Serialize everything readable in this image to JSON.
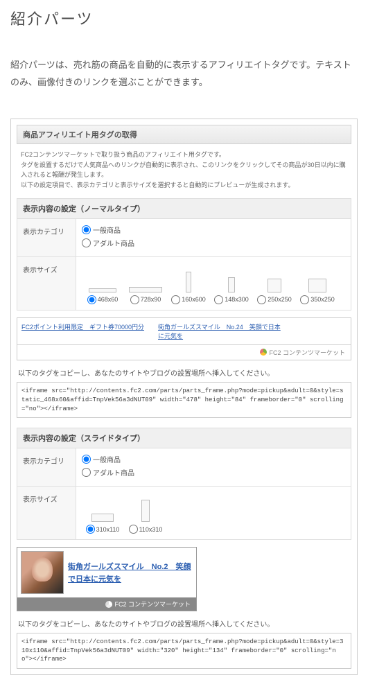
{
  "page": {
    "title": "紹介パーツ",
    "intro": "紹介パーツは、売れ筋の商品を自動的に表示するアフィリエイトタグです。テキストのみ、画像付きのリンクを選ぶことができます。"
  },
  "panel": {
    "header": "商品アフィリエイト用タグの取得",
    "desc_line1": "FC2コンテンツマーケットで取り扱う商品のアフィリエイト用タグです。",
    "desc_line2": "タグを設置するだけで人気商品へのリンクが自動的に表示され、このリンクをクリックしてその商品が30日以内に購入されると報酬が発生します。",
    "desc_line3": "以下の設定項目で、表示カテゴリと表示サイズを選択すると自動的にプレビューが生成されます。"
  },
  "normal": {
    "section_title": "表示内容の設定（ノーマルタイプ）",
    "category_label": "表示カテゴリ",
    "cat_general": "一般商品",
    "cat_adult": "アダルト商品",
    "size_label": "表示サイズ",
    "sizes": {
      "s1": "468x60",
      "s2": "728x90",
      "s3": "160x600",
      "s4": "148x300",
      "s5": "250x250",
      "s6": "350x250"
    },
    "preview_link1": "FC2ポイント利用限定　ギフト券70000円分",
    "preview_link2": "街角ガールズスマイル　No.24　笑顔で日本に元気を",
    "preview_footer": "FC2 コンテンツマーケット",
    "copy_instruction": "以下のタグをコピーし、あなたのサイトやブログの設置場所へ挿入してください。",
    "code": "<iframe src=\"http://contents.fc2.com/parts/parts_frame.php?mode=pickup&adult=0&style=static_468x60&affid=TnpVek56a3dNUT09\" width=\"478\" height=\"84\" frameborder=\"0\" scrolling=\"no\"></iframe>"
  },
  "slide": {
    "section_title": "表示内容の設定（スライドタイプ）",
    "category_label": "表示カテゴリ",
    "cat_general": "一般商品",
    "cat_adult": "アダルト商品",
    "size_label": "表示サイズ",
    "sizes": {
      "s1": "310x110",
      "s2": "110x310"
    },
    "preview_title": "街角ガールズスマイル　No.2　笑顔で日本に元気を",
    "preview_footer": "FC2 コンテンツマーケット",
    "copy_instruction": "以下のタグをコピーし、あなたのサイトやブログの設置場所へ挿入してください。",
    "code": "<iframe src=\"http://contents.fc2.com/parts/parts_frame.php?mode=pickup&adult=0&style=310x110&affid=TnpVek56a3dNUT09\" width=\"320\" height=\"134\" frameborder=\"0\" scrolling=\"no\"></iframe>"
  }
}
